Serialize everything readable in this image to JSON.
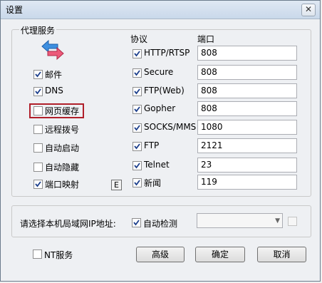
{
  "window": {
    "title": "设置",
    "close_label": "✕"
  },
  "proxy": {
    "group_label": "代理服务",
    "left_items": [
      {
        "label": "邮件",
        "checked": true
      },
      {
        "label": "DNS",
        "checked": true
      },
      {
        "label": "网页缓存",
        "checked": false
      },
      {
        "label": "远程拨号",
        "checked": false
      },
      {
        "label": "自动启动",
        "checked": false
      },
      {
        "label": "自动隐藏",
        "checked": false
      },
      {
        "label": "端口映射",
        "checked": true
      }
    ],
    "e_button": "E",
    "protocol_header": "协议",
    "port_header": "端口",
    "protocols": [
      {
        "label": "HTTP/RTSP",
        "checked": true,
        "port": "808"
      },
      {
        "label": "Secure",
        "checked": true,
        "port": "808"
      },
      {
        "label": "FTP(Web)",
        "checked": true,
        "port": "808"
      },
      {
        "label": "Gopher",
        "checked": true,
        "port": "808"
      },
      {
        "label": "SOCKS/MMS",
        "checked": true,
        "port": "1080"
      },
      {
        "label": "FTP",
        "checked": true,
        "port": "2121"
      },
      {
        "label": "Telnet",
        "checked": true,
        "port": "23"
      },
      {
        "label": "新闻",
        "checked": true,
        "port": "119"
      }
    ]
  },
  "lan": {
    "label": "请选择本机局域网IP地址:",
    "auto_detect_label": "自动检测",
    "auto_detect_checked": true,
    "ip_value": ""
  },
  "bottom": {
    "nt_service_label": "NT服务",
    "advanced_button": "高级",
    "ok_button": "确定",
    "cancel_button": "取消"
  },
  "icons": {
    "arrows_icon": "double-arrow-icon"
  }
}
